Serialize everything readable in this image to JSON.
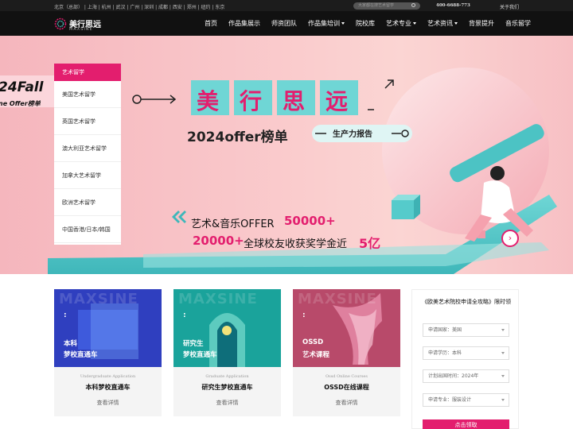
{
  "topbar": {
    "cities": "北京（总部） | 上海 | 杭州 | 武汉 | 广州 | 深圳 | 成都 | 西安 | 郑州 | 纽约 | 东京",
    "search_placeholder": "大家都在搜艺术留学",
    "phone": "400-6688-773",
    "about": "关于我们"
  },
  "brand": {
    "name_cn": "美行思远",
    "name_en": "MAXSINE"
  },
  "nav": [
    {
      "label": "首页",
      "dropdown": false
    },
    {
      "label": "作品集展示",
      "dropdown": false
    },
    {
      "label": "师资团队",
      "dropdown": false
    },
    {
      "label": "作品集培训",
      "dropdown": true
    },
    {
      "label": "院校库",
      "dropdown": false
    },
    {
      "label": "艺术专业",
      "dropdown": true
    },
    {
      "label": "艺术资讯",
      "dropdown": true
    },
    {
      "label": "背景提升",
      "dropdown": false
    },
    {
      "label": "音乐留学",
      "dropdown": false
    }
  ],
  "sidemenu": {
    "header": "艺术留学",
    "items": [
      "美国艺术留学",
      "英国艺术留学",
      "澳大利亚艺术留学",
      "加拿大艺术留学",
      "欧洲艺术留学",
      "中国香港/日本/韩国"
    ]
  },
  "banner": {
    "fall_badge_1": "24Fall",
    "fall_badge_2": "ne Offer榜单",
    "title_chars": [
      "美",
      "行",
      "思",
      "远"
    ],
    "subtitle": "2024offer榜单",
    "report_tag": "生产力报告",
    "stat1_label": "艺术&音乐OFFER",
    "stat1_value": "50000+",
    "stat2_value": "20000+",
    "stat2_label": "全球校友收获奖学金近",
    "stat2_amount": "5亿"
  },
  "cards": [
    {
      "watermark": "MAXSINE",
      "line1": "本科",
      "line2": "梦校直通车",
      "en": "Undergraduate Application",
      "title": "本科梦校直通车",
      "more": "查看详情",
      "bg": "#2f3fbf"
    },
    {
      "watermark": "MAXSINE",
      "line1": "研究生",
      "line2": "梦校直通车",
      "en": "Graduate Application",
      "title": "研究生梦校直通车",
      "more": "查看详情",
      "bg": "#1aa39b"
    },
    {
      "watermark": "MAXSINE",
      "line1": "OSSD",
      "line2": "艺术课程",
      "en": "Ossd Online Courses",
      "title": "OSSD在线课程",
      "more": "查看详情",
      "bg": "#b84a6a"
    }
  ],
  "form": {
    "title": "《欧美艺术院校申请全攻略》限时领",
    "fields": [
      "申请国家：美国",
      "申请学历：本科",
      "计划出国时间：2024年",
      "申请专业：服装设计"
    ],
    "submit": "点击领取"
  },
  "colors": {
    "accent": "#e31e6e",
    "teal": "#4cc3c4",
    "nav_bg": "#111111"
  }
}
